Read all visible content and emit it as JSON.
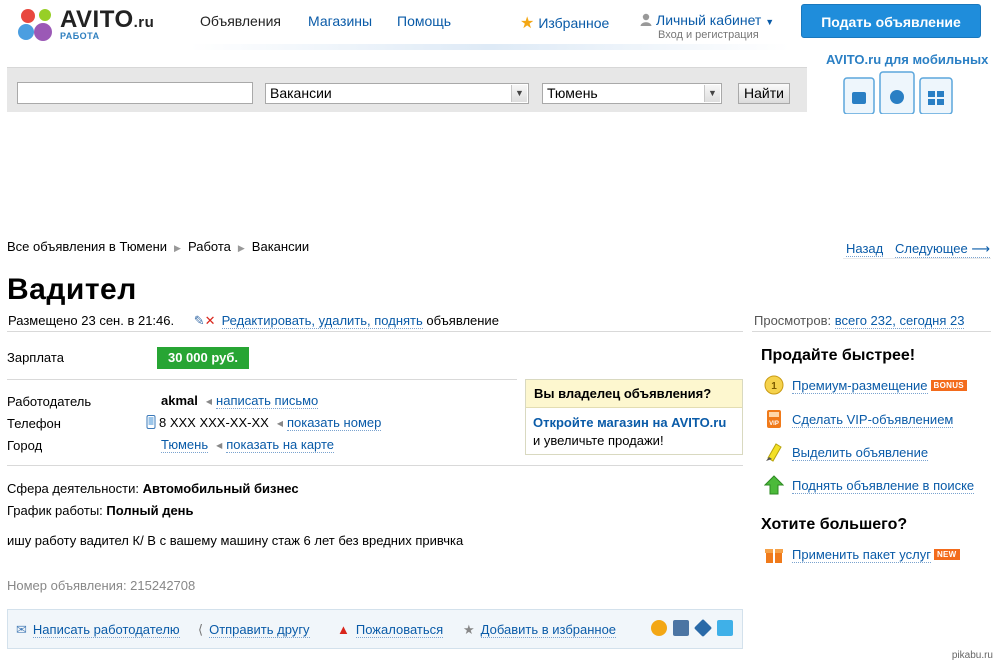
{
  "header": {
    "logo_text": "AVITO",
    "logo_domain": ".ru",
    "logo_sub": "РАБОТА",
    "nav": [
      "Объявления",
      "Магазины",
      "Помощь"
    ],
    "favorites": "Избранное",
    "cabinet": "Личный кабинет",
    "cabinet_sub": "Вход и регистрация",
    "post_button": "Подать объявление",
    "mobile_title": "AVITO.ru для мобильных"
  },
  "search": {
    "query": "",
    "category": "Вакансии",
    "city": "Тюмень",
    "button": "Найти"
  },
  "breadcrumb": [
    "Все объявления в Тюмени",
    "Работа",
    "Вакансии"
  ],
  "pager": {
    "back": "Назад",
    "next": "Следующее ⟶"
  },
  "ad": {
    "title": "Вадител",
    "posted": "Размещено 23 сен. в 21:46.",
    "edit_link": "Редактировать, удалить, поднять",
    "edit_suffix": "объявление",
    "views_label": "Просмотров:",
    "views_link": "всего 232, сегодня 23",
    "salary_label": "Зарплата",
    "salary": "30 000 руб.",
    "employer_label": "Работодатель",
    "employer": "akmal",
    "write_letter": "написать письмо",
    "phone_label": "Телефон",
    "phone": "8 XXX XXX-XX-XX",
    "show_number": "показать номер",
    "city_label": "Город",
    "city": "Тюмень",
    "show_map": "показать на карте",
    "sphere_label": "Сфера деятельности:",
    "sphere": "Автомобильный бизнес",
    "schedule_label": "График работы:",
    "schedule": "Полный день",
    "description": "ишу работу вадител К/ В с вашему машину стаж 6 лет без вредних привчка",
    "ad_number": "Номер объявления: 215242708"
  },
  "owner_box": {
    "title": "Вы владелец объявления?",
    "link": "Откройте магазин на AVITO.ru",
    "text": "и увеличьте продажи!"
  },
  "sidebar": {
    "sell_faster": "Продайте быстрее!",
    "items": [
      {
        "label": "Премиум-размещение",
        "badge": "BONUS",
        "icon": "premium-coin-icon"
      },
      {
        "label": "Сделать VIP-объявлением",
        "icon": "vip-icon"
      },
      {
        "label": "Выделить объявление",
        "icon": "highlight-marker-icon"
      },
      {
        "label": "Поднять объявление в поиске",
        "icon": "arrow-up-icon"
      }
    ],
    "want_more": "Хотите большего?",
    "package": {
      "label": "Применить пакет услуг",
      "badge": "NEW",
      "icon": "gift-box-icon"
    }
  },
  "actions": {
    "write": "Написать работодателю",
    "send": "Отправить другу",
    "complain": "Пожаловаться",
    "favorite": "Добавить в избранное"
  },
  "watermark": "pikabu.ru"
}
